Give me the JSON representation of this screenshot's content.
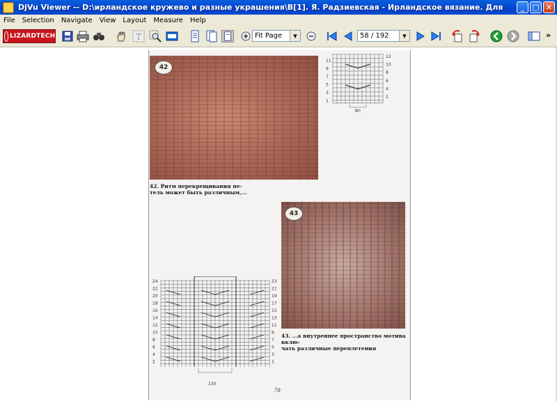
{
  "window": {
    "title": "DjVu Viewer -- D:\\ирландское кружево и разные украшения\\В[1]. Я. Радзиевская - Ирландское вязание. Для тех, кто любит вязать.djvu",
    "minimize": "_",
    "maximize": "□",
    "close": "✕"
  },
  "menu": [
    "File",
    "Selection",
    "Navigate",
    "View",
    "Layout",
    "Measure",
    "Help"
  ],
  "toolbar": {
    "logo": "LIZARDTECH",
    "zoom_value": "Fit Page",
    "page_value": "58 / 192",
    "overflow": "»"
  },
  "page": {
    "badge_top": "42",
    "badge_bottom": "43",
    "caption_top_1": "42. Ритм перекрещивания пе-",
    "caption_top_2": "тель может быть различным,...",
    "caption_bottom_1": "43. ...а внутреннее пространство мотива вклю-",
    "caption_bottom_2": "чать различные переплетения",
    "chart_top_width_label": "8п",
    "chart_bottom_width_label": "13п",
    "page_number": "78",
    "chart_top_rows": [
      "12",
      "11",
      "10",
      "9",
      "8",
      "7",
      "6",
      "5",
      "4",
      "3",
      "2",
      "1"
    ],
    "chart_bottom_left_rows": [
      "24",
      "22",
      "20",
      "18",
      "16",
      "14",
      "12",
      "10",
      "8",
      "6",
      "4",
      "2"
    ],
    "chart_bottom_right_rows": [
      "23",
      "21",
      "19",
      "17",
      "15",
      "13",
      "11",
      "9",
      "7",
      "5",
      "3",
      "1"
    ]
  }
}
